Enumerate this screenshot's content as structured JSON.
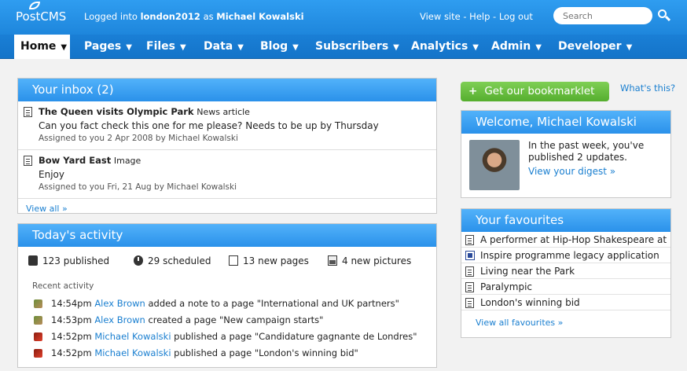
{
  "header": {
    "logo": "PostCMS",
    "logged_prefix": "Logged into",
    "site": "london2012",
    "as_word": "as",
    "user": "Michael Kowalski",
    "links": "View site - Help - Log out",
    "search_placeholder": "Search"
  },
  "nav": [
    "Home",
    "Pages",
    "Files",
    "Data",
    "Blog",
    "Subscribers",
    "Analytics",
    "Admin",
    "Developer"
  ],
  "inbox": {
    "title": "Your inbox (2)",
    "items": [
      {
        "title": "The Queen visits Olympic Park",
        "type": "News article",
        "text": "Can you fact check this one for me please? Needs to be up by Thursday",
        "meta": "Assigned to you 2 Apr 2008 by Michael Kowalski"
      },
      {
        "title": "Bow Yard East",
        "type": "Image",
        "text": "Enjoy",
        "meta": "Assigned to you Fri, 21 Aug by Michael Kowalski"
      }
    ],
    "view_all": "View all »"
  },
  "activity": {
    "title": "Today's activity",
    "stats": {
      "published": "123 published",
      "scheduled": "29 scheduled",
      "pages": "13 new pages",
      "pictures": "4 new pictures"
    },
    "recent_label": "Recent activity",
    "items": [
      {
        "time": "14:54pm",
        "user": "Alex Brown",
        "text": "added a note to a page \"International and UK partners\"",
        "avatar": "green"
      },
      {
        "time": "14:53pm",
        "user": "Alex Brown",
        "text": "created a page \"New campaign starts\"",
        "avatar": "green"
      },
      {
        "time": "14:52pm",
        "user": "Michael Kowalski",
        "text": "published a page \"Candidature gagnante de Londres\"",
        "avatar": "red"
      },
      {
        "time": "14:52pm",
        "user": "Michael Kowalski",
        "text": "published a page \"London's winning bid\"",
        "avatar": "red"
      }
    ]
  },
  "bookmarklet": {
    "label": "Get our bookmarklet",
    "whats_this": "What's this?"
  },
  "welcome": {
    "title": "Welcome, Michael Kowalski",
    "text": "In the past week, you've published 2 updates.",
    "digest": "View your digest »"
  },
  "favourites": {
    "title": "Your favourites",
    "items": [
      {
        "label": "A performer at Hip-Hop Shakespeare at",
        "icon": "doc-icon"
      },
      {
        "label": "Inspire programme legacy application",
        "icon": "word-doc-icon"
      },
      {
        "label": "Living near the Park",
        "icon": "doc-icon"
      },
      {
        "label": "Paralympic",
        "icon": "doc-icon"
      },
      {
        "label": "London's winning bid",
        "icon": "doc-icon"
      }
    ],
    "view_all": "View all favourites »"
  },
  "colors": {
    "brand_blue": "#1e86dc",
    "link": "#1a7fd0",
    "green_button": "#55ae2e"
  }
}
